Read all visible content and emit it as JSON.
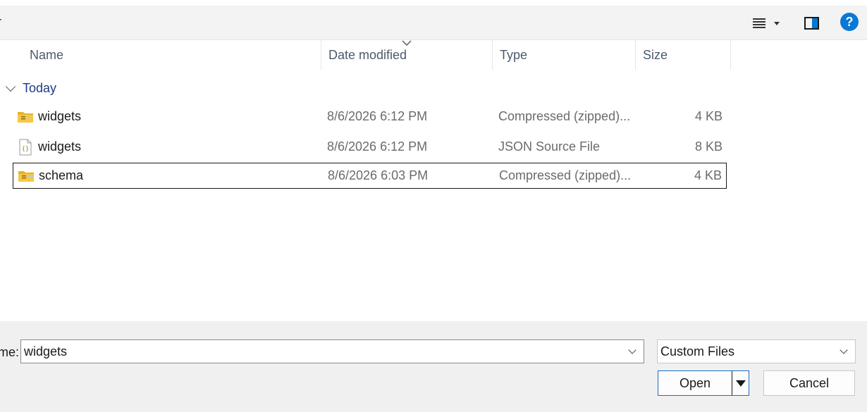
{
  "toolbar": {
    "clipped_text": "r",
    "view_menu_icon": "list-view-icon",
    "preview_icon": "preview-pane-icon",
    "help_label": "?"
  },
  "columns": {
    "name": "Name",
    "date_modified": "Date modified",
    "type": "Type",
    "size": "Size"
  },
  "group": {
    "label": "Today"
  },
  "files": [
    {
      "name": "widgets",
      "date": "8/6/2026 6:12 PM",
      "type": "Compressed (zipped)...",
      "size": "4 KB",
      "icon": "zip-folder-icon"
    },
    {
      "name": "widgets",
      "date": "8/6/2026 6:12 PM",
      "type": "JSON Source File",
      "size": "8 KB",
      "icon": "json-file-icon"
    },
    {
      "name": "schema",
      "date": "8/6/2026 6:03 PM",
      "type": "Compressed (zipped)...",
      "size": "4 KB",
      "icon": "zip-folder-icon"
    }
  ],
  "bottom": {
    "filename_label": "me:",
    "filename_value": "widgets",
    "filter_value": "Custom Files",
    "open_label": "Open",
    "cancel_label": "Cancel"
  },
  "colors": {
    "accent": "#0a78d7",
    "group_label": "#1e3a8a"
  }
}
